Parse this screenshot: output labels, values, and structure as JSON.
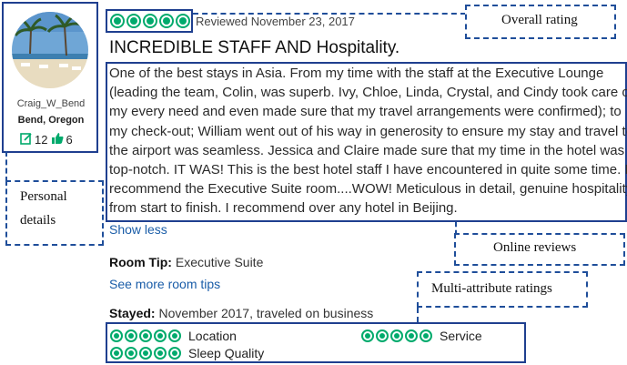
{
  "reviewer": {
    "name": "Craig_W_Bend",
    "location": "Bend, Oregon",
    "contributions": "12",
    "helpful_votes": "6"
  },
  "review": {
    "bubble_rating": 5,
    "reviewed_date": "Reviewed November 23, 2017",
    "title": "INCREDIBLE STAFF AND Hospitality.",
    "body_lines": [
      "One of the best stays in Asia. From my time with the staff at the Executive Lounge",
      "(leading the team, Colin, was superb. Ivy, Chloe, Linda, Crystal, and Cindy took care of",
      "my every need and even made sure that my travel arrangements were confirmed); to",
      "my check-out; William went out of his way in generosity to ensure my stay and travel to",
      "the airport was seamless. Jessica and Claire made sure that my time in the hotel was",
      "top-notch. IT WAS! This is the best hotel staff I have encountered in quite some time. I",
      "recommend the Executive Suite room....WOW! Meticulous in detail, genuine hospitality",
      "from start to finish. I recommend over any hotel in Beijing."
    ],
    "show_less": "Show less",
    "room_tip_label": "Room Tip:",
    "room_tip_value": "Executive Suite",
    "see_more_tips": "See more room tips",
    "stayed_label": "Stayed:",
    "stayed_value": "November 2017, traveled on business"
  },
  "attribute_ratings": [
    {
      "label": "Location",
      "rating": 5
    },
    {
      "label": "Service",
      "rating": 5
    },
    {
      "label": "Sleep Quality",
      "rating": 5
    }
  ],
  "annotations": {
    "overall_rating": "Overall rating",
    "personal_details_line1": "Personal",
    "personal_details_line2": "details",
    "online_reviews": "Online reviews",
    "multi_attribute": "Multi-attribute ratings"
  },
  "colors": {
    "bubble_green": "#00aa6c",
    "annotation_blue": "#1f4e9a",
    "link_blue": "#1a5da8"
  }
}
